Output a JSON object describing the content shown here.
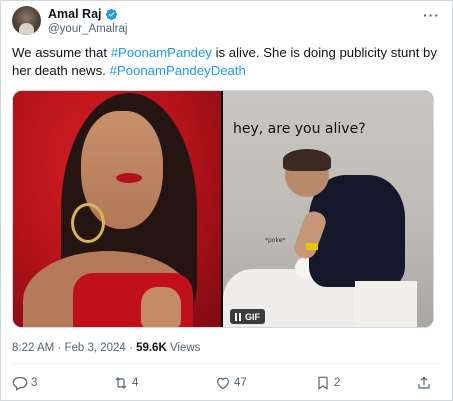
{
  "author": {
    "name": "Amal Raj",
    "handle": "@your_Amalraj",
    "verified": true
  },
  "header": {
    "more_icon": "more-dots-icon",
    "more_label": "···"
  },
  "tweet": {
    "text_parts": [
      "We assume that ",
      "#PoonamPandey",
      " is alive. She is doing publicity stunt by her death news. ",
      "#PoonamPandeyDeath"
    ]
  },
  "media": {
    "right_caption": "hey, are you alive?",
    "right_small_text": "*poke*",
    "gif_label": "GIF"
  },
  "meta": {
    "time": "8:22 AM",
    "separator": " · ",
    "date": "Feb 3, 2024",
    "views_count": "59.6K",
    "views_label": " Views"
  },
  "actions": {
    "reply_count": "3",
    "repost_count": "4",
    "like_count": "47",
    "bookmark_count": "2"
  },
  "colors": {
    "link": "#1d9bf0",
    "muted": "#536471",
    "text": "#0f1419",
    "verified": "#1d9bf0"
  }
}
